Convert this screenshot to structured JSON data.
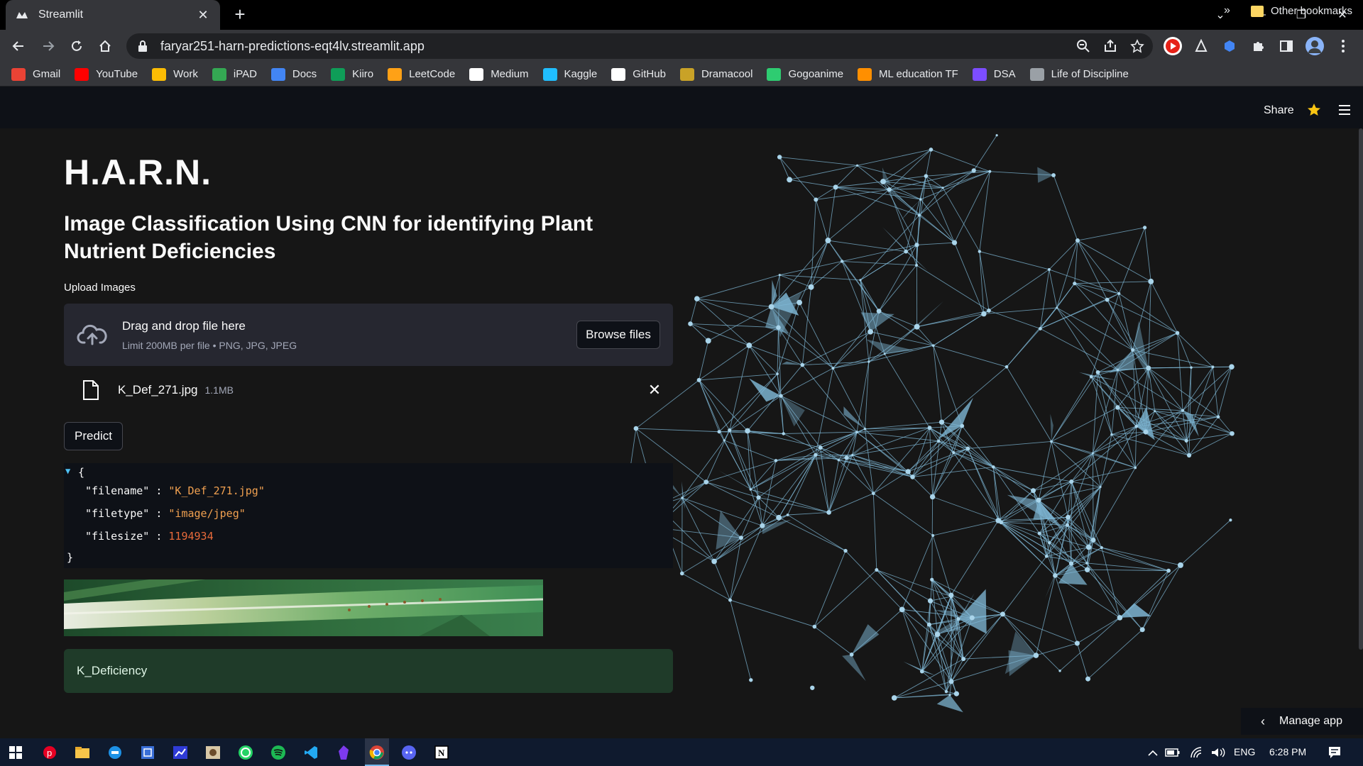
{
  "browser": {
    "tab_title": "Streamlit",
    "url": "faryar251-harn-predictions-eqt4lv.streamlit.app",
    "bookmarks": [
      {
        "label": "Gmail",
        "color": "#ea4335"
      },
      {
        "label": "YouTube",
        "color": "#ff0000"
      },
      {
        "label": "Work",
        "color": "#fbbc04"
      },
      {
        "label": "iPAD",
        "color": "#34a853"
      },
      {
        "label": "Docs",
        "color": "#4285f4"
      },
      {
        "label": "Kiiro",
        "color": "#0f9d58"
      },
      {
        "label": "LeetCode",
        "color": "#ffa116"
      },
      {
        "label": "Medium",
        "color": "#ffffff"
      },
      {
        "label": "Kaggle",
        "color": "#20beff"
      },
      {
        "label": "GitHub",
        "color": "#ffffff"
      },
      {
        "label": "Dramacool",
        "color": "#c9a227"
      },
      {
        "label": "Gogoanime",
        "color": "#2ecc71"
      },
      {
        "label": "ML education TF",
        "color": "#ff8f00"
      },
      {
        "label": "DSA",
        "color": "#7c4dff"
      },
      {
        "label": "Life of Discipline",
        "color": "#9aa0a6"
      }
    ],
    "bookmarks_more": "»",
    "other_bookmarks": "Other bookmarks"
  },
  "header": {
    "share_label": "Share"
  },
  "app": {
    "title": "H.A.R.N.",
    "subtitle": "Image Classification Using CNN for identifying Plant Nutrient Deficiencies",
    "upload_label": "Upload Images",
    "dropzone": {
      "main": "Drag and drop file here",
      "sub": "Limit 200MB per file • PNG, JPG, JPEG",
      "browse_label": "Browse files"
    },
    "file": {
      "name": "K_Def_271.jpg",
      "size": "1.1MB"
    },
    "predict_label": "Predict",
    "json_output": {
      "open": "{",
      "close": "}",
      "filename_key": "\"filename\"",
      "filename_val": "\"K_Def_271.jpg\"",
      "filetype_key": "\"filetype\"",
      "filetype_val": "\"image/jpeg\"",
      "filesize_key": "\"filesize\"",
      "filesize_val": "1194934",
      "sep": ":"
    },
    "result": "K_Deficiency",
    "manage_app": "Manage app"
  },
  "taskbar": {
    "language": "ENG",
    "time": "6:28 PM"
  },
  "colors": {
    "bg": "#0e1117",
    "secondary_bg": "#262730",
    "success_bg": "#1f3b29",
    "network_line": "#7fb8d6"
  }
}
